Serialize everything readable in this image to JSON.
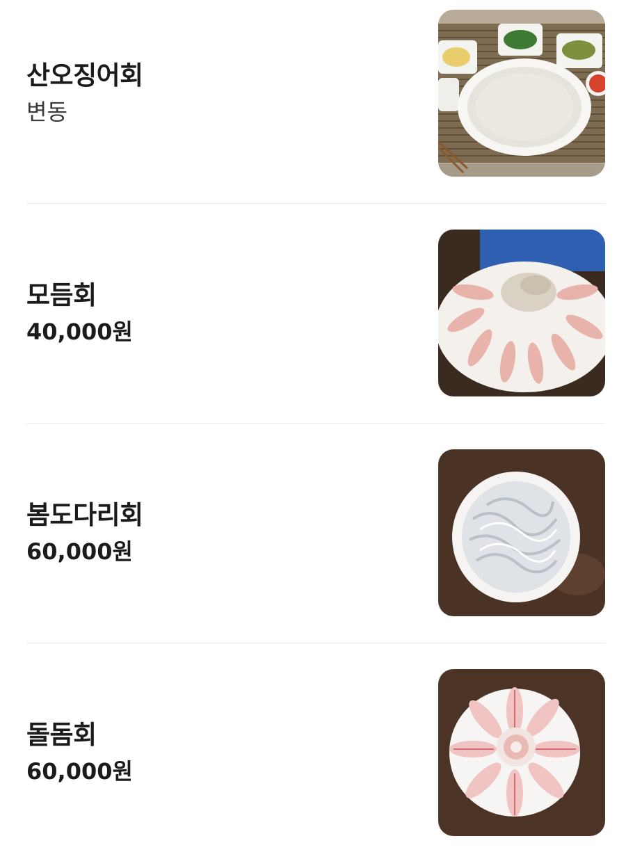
{
  "menu": {
    "items": [
      {
        "name": "산오징어회",
        "price": "변동",
        "image": "squid-sashimi-photo"
      },
      {
        "name": "모듬회",
        "price": "40,000원",
        "image": "assorted-sashimi-photo"
      },
      {
        "name": "봄도다리회",
        "price": "60,000원",
        "image": "spring-flounder-sashimi-photo"
      },
      {
        "name": "돌돔회",
        "price": "60,000원",
        "image": "rock-bream-sashimi-photo"
      }
    ]
  }
}
